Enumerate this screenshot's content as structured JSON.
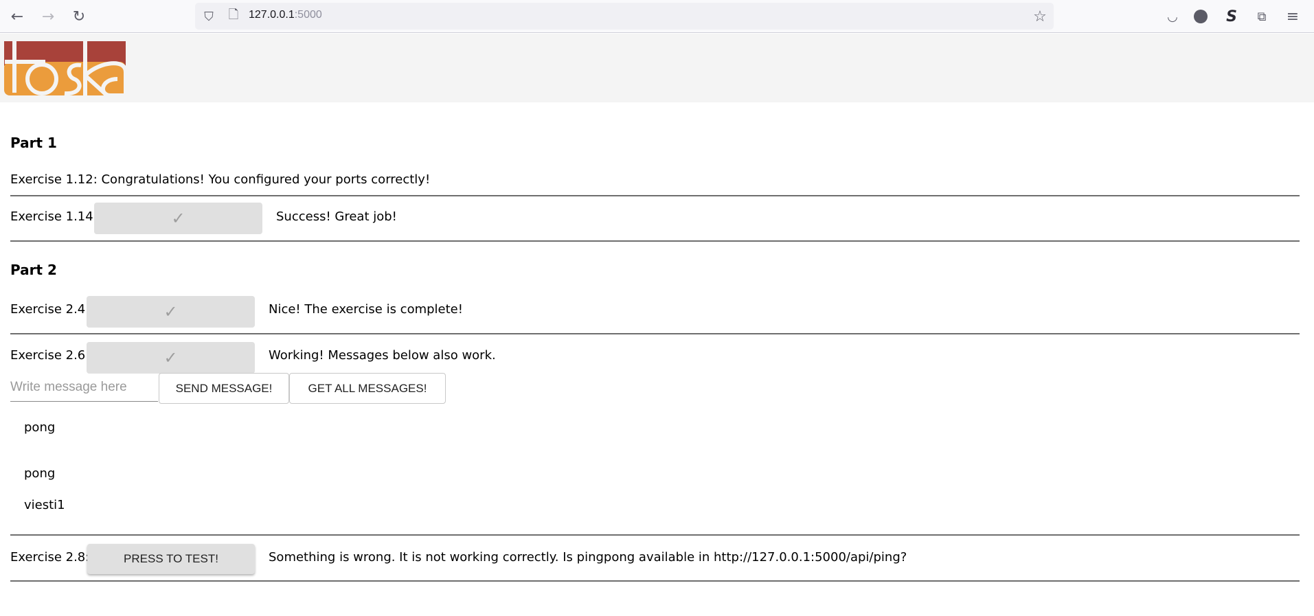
{
  "browser": {
    "url_host": "127.0.0.1",
    "url_port": ":5000"
  },
  "logo": {
    "text": "itoska"
  },
  "part1": {
    "heading": "Part 1",
    "ex112": "Exercise 1.12: Congratulations! You configured your ports correctly!",
    "ex114": {
      "label": "Exercise 1.14:",
      "status": "Success! Great job!"
    }
  },
  "part2": {
    "heading": "Part 2",
    "ex24": {
      "label": "Exercise 2.4:",
      "status": "Nice! The exercise is complete!"
    },
    "ex26": {
      "label": "Exercise 2.6:",
      "status": "Working! Messages below also work.",
      "input_placeholder": "Write message here",
      "send_label": "SEND MESSAGE!",
      "get_label": "GET ALL MESSAGES!",
      "messages": [
        "pong",
        "pong",
        "viesti1"
      ]
    },
    "ex28": {
      "label": "Exercise 2.8:",
      "button": "PRESS TO TEST!",
      "status": "Something is wrong. It is not working correctly. Is pingpong available in http://127.0.0.1:5000/api/ping?"
    }
  },
  "colors": {
    "logo_top": "#a8423a",
    "logo_bottom": "#eb9c3c"
  }
}
